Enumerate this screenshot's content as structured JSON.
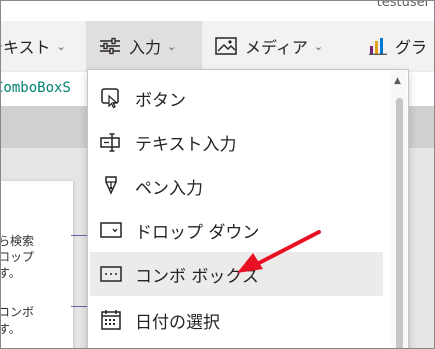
{
  "header": {
    "user": "testuser"
  },
  "ribbon": {
    "tabs": [
      {
        "label": "テキスト"
      },
      {
        "label": "入力"
      },
      {
        "label": "メディア"
      },
      {
        "label": "グラ"
      }
    ]
  },
  "namebox": {
    "value": "ComboBoxS"
  },
  "canvas": {
    "side_texts": [
      "ら検索",
      "ロップ",
      "す。",
      "コンボ",
      "す。"
    ]
  },
  "input_menu": {
    "items": [
      {
        "label": "ボタン",
        "icon": "button-icon"
      },
      {
        "label": "テキスト入力",
        "icon": "text-input-icon"
      },
      {
        "label": "ペン入力",
        "icon": "pen-icon"
      },
      {
        "label": "ドロップ ダウン",
        "icon": "dropdown-icon"
      },
      {
        "label": "コンボ ボックス",
        "icon": "combobox-icon"
      },
      {
        "label": "日付の選択",
        "icon": "calendar-icon"
      }
    ],
    "highlighted": "コンボ ボックス"
  },
  "annotation": {
    "arrow_color": "#e81123"
  }
}
